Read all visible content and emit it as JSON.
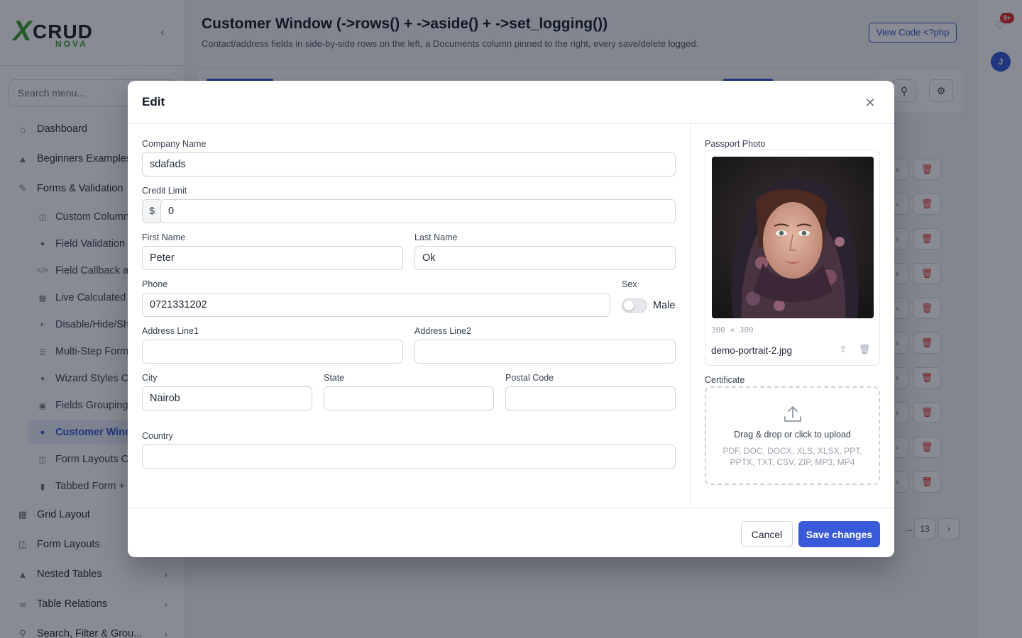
{
  "sidebar": {
    "logo": {
      "x": "X",
      "crud": "CRUD",
      "nova": "NOVA"
    },
    "search_placeholder": "Search menu...",
    "items": [
      {
        "label": "Dashboard",
        "icon": "home-icon"
      },
      {
        "label": "Beginners Examples",
        "icon": "graduation-cap-icon"
      },
      {
        "label": "Forms & Validation",
        "icon": "edit-icon"
      }
    ],
    "sub_items": [
      {
        "label": "Custom Columns",
        "icon": "columns-icon"
      },
      {
        "label": "Field Validation",
        "icon": "check-circle-icon"
      },
      {
        "label": "Field Callback a",
        "icon": "code-icon"
      },
      {
        "label": "Live Calculated",
        "icon": "calculator-icon"
      },
      {
        "label": "Disable/Hide/Sh",
        "icon": "toggle-icon"
      },
      {
        "label": "Multi-Step Form",
        "icon": "list-icon"
      },
      {
        "label": "Wizard Styles C",
        "icon": "wand-icon"
      },
      {
        "label": "Fields Grouping",
        "icon": "group-icon"
      },
      {
        "label": "Customer Wind",
        "icon": "user-icon"
      },
      {
        "label": "Form Layouts C",
        "icon": "columns-icon"
      },
      {
        "label": "Tabbed Form +",
        "icon": "file-icon"
      }
    ],
    "bottom_items": [
      {
        "label": "Grid Layout",
        "icon": "grid-icon"
      },
      {
        "label": "Form Layouts",
        "icon": "columns-icon"
      },
      {
        "label": "Nested Tables",
        "icon": "sitemap-icon"
      },
      {
        "label": "Table Relations",
        "icon": "link-icon"
      },
      {
        "label": "Search, Filter & Grou...",
        "icon": "search-icon"
      }
    ]
  },
  "header": {
    "title": "Customer Window (->rows() + ->aside() + ->set_logging())",
    "subtitle": "Contact/address fields in side-by-side rows on the left, a Documents column pinned to the right, every save/delete logged.",
    "view_code": "View Code <?php"
  },
  "rail": {
    "badge": "9+",
    "avatar": "J"
  },
  "pagination": {
    "last_page": "13",
    "ellipsis": "..."
  },
  "modal": {
    "title": "Edit",
    "fields": {
      "company_name": {
        "label": "Company Name",
        "value": "sdafads"
      },
      "credit_limit": {
        "label": "Credit Limit",
        "prefix": "$",
        "value": "0"
      },
      "first_name": {
        "label": "First Name",
        "value": "Peter"
      },
      "last_name": {
        "label": "Last Name",
        "value": "Ok"
      },
      "phone": {
        "label": "Phone",
        "value": "0721331202"
      },
      "sex": {
        "label": "Sex",
        "value": "Male",
        "toggle_on": false
      },
      "address_line1": {
        "label": "Address Line1",
        "value": ""
      },
      "address_line2": {
        "label": "Address Line2",
        "value": ""
      },
      "city": {
        "label": "City",
        "value": "Nairob"
      },
      "state": {
        "label": "State",
        "value": ""
      },
      "postal_code": {
        "label": "Postal Code",
        "value": ""
      },
      "country": {
        "label": "Country",
        "value": ""
      }
    },
    "aside": {
      "passport_photo": {
        "label": "Passport Photo",
        "dims": "300 × 300",
        "filename": "demo-portrait-2.jpg"
      },
      "certificate": {
        "label": "Certificate",
        "drop_text": "Drag & drop or click to upload",
        "types": "PDF, DOC, DOCX, XLS, XLSX, PPT, PPTX, TXT, CSV, ZIP, MP3, MP4"
      }
    },
    "footer": {
      "cancel": "Cancel",
      "save": "Save changes"
    }
  },
  "colors": {
    "primary": "#3a5bd9",
    "danger": "#dc2626",
    "brand_green": "#3a9a2c"
  }
}
